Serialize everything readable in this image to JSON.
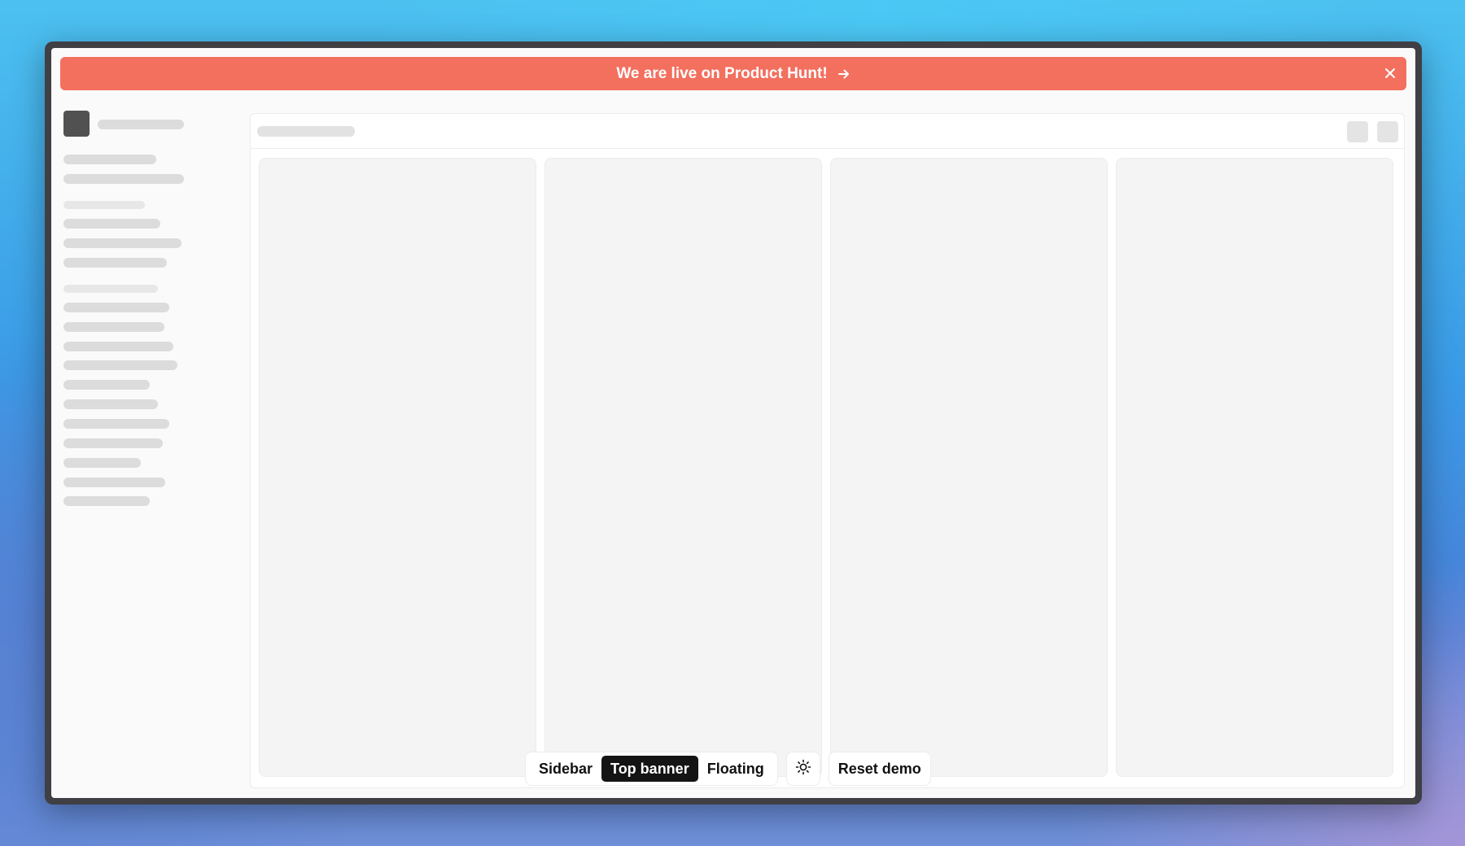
{
  "banner": {
    "text": "We are live on Product Hunt!",
    "background_color": "#f36f5e",
    "arrow_icon": "arrow-right-icon",
    "close_icon": "close-icon"
  },
  "toolbar": {
    "layout_options": [
      {
        "label": "Sidebar",
        "active": false
      },
      {
        "label": "Top banner",
        "active": true
      },
      {
        "label": "Floating",
        "active": false
      }
    ],
    "theme_icon": "sun-icon",
    "reset_label": "Reset demo"
  },
  "colors": {
    "banner": "#f36f5e",
    "active_segment": "#141414",
    "window_frame": "#3f3f44"
  }
}
